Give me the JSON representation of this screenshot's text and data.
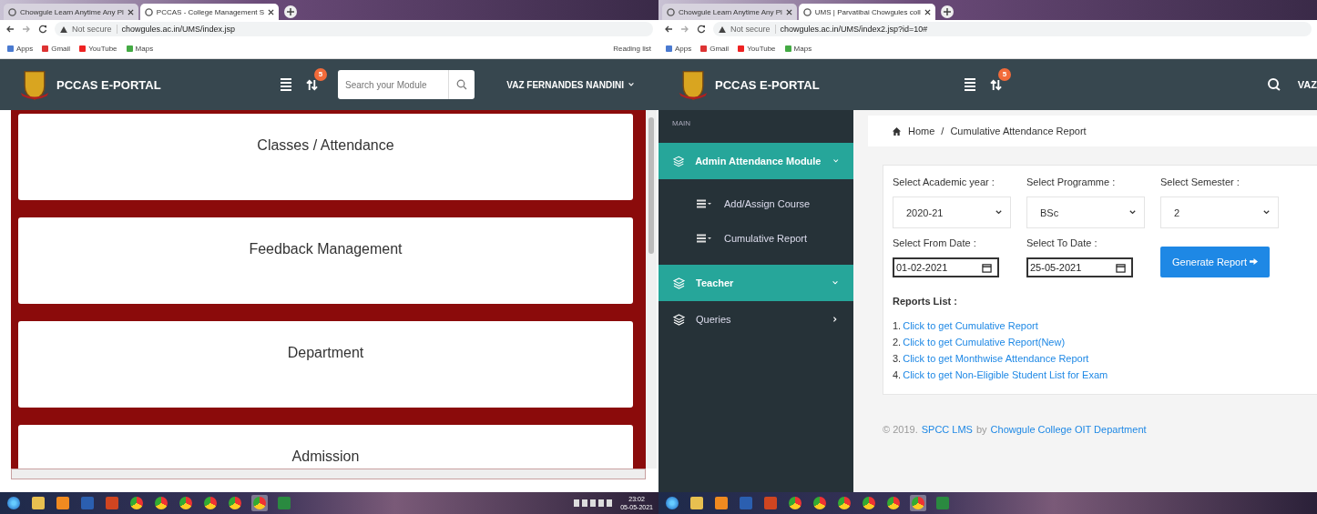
{
  "left_window": {
    "tabs": [
      {
        "label": "Chowgule Learn Anytime Any Pl",
        "selected": false
      },
      {
        "label": "PCCAS - College Management S",
        "selected": true
      }
    ],
    "security": "Not secure",
    "url": "chowgules.ac.in/UMS/index.jsp",
    "bookmarks": [
      "Apps",
      "Gmail",
      "YouTube",
      "Maps"
    ],
    "reading_list": "Reading list",
    "header": {
      "brand": "PCCAS E-PORTAL",
      "badge": "5",
      "search": {
        "placeholder": "Search your Module"
      },
      "user": "VAZ FERNANDES NANDINI"
    },
    "modules": [
      "Classes / Attendance",
      "Feedback Management",
      "Department",
      "Admission"
    ],
    "clock": {
      "time": "23:02",
      "date": "05-05-2021"
    }
  },
  "right_window": {
    "tabs": [
      {
        "label": "Chowgule Learn Anytime Any Pl",
        "selected": false
      },
      {
        "label": "UMS | Parvatibai Chowgules coll",
        "selected": true
      }
    ],
    "security": "Not secure",
    "url": "chowgules.ac.in/UMS/index2.jsp?id=10#",
    "bookmarks": [
      "Apps",
      "Gmail",
      "YouTube",
      "Maps"
    ],
    "header": {
      "brand": "PCCAS E-PORTAL",
      "badge": "5",
      "user": "VAZ"
    },
    "sidebar": {
      "section": "MAIN",
      "items": [
        {
          "label": "Admin Attendance Module",
          "selected": true,
          "expanded": true,
          "children": [
            "Add/Assign Course",
            "Cumulative Report"
          ]
        },
        {
          "label": "Teacher",
          "selected": true,
          "expanded": false
        },
        {
          "label": "Queries",
          "selected": false,
          "expanded": false
        }
      ]
    },
    "breadcrumb": [
      "Home",
      "/",
      "Cumulative Attendance Report"
    ],
    "selects": [
      {
        "label": "Select Academic year :",
        "value": "2020-21"
      },
      {
        "label": "Select Programme :",
        "value": "BSc"
      },
      {
        "label": "Select Semester :",
        "value": "2"
      }
    ],
    "dates": [
      {
        "label": "Select From Date :",
        "value": "01-02-2021"
      },
      {
        "label": "Select To Date :",
        "value": "25-05-2021"
      }
    ],
    "generate_button": "Generate Report",
    "reports_title": "Reports List :",
    "reports": [
      {
        "number": "1.",
        "link": "Click to get Cumulative Report"
      },
      {
        "number": "2.",
        "link": "Click to get Cumulative Report(New)"
      },
      {
        "number": "3.",
        "link": "Click to get Monthwise Attendance Report"
      },
      {
        "number": "4.",
        "link": "Click to get Non-Eligible Student List for Exam"
      }
    ],
    "footer": {
      "copyright": "© 2019.",
      "product_link": "SPCC LMS",
      "by": "by",
      "org_link": "Chowgule College OIT Department"
    }
  }
}
